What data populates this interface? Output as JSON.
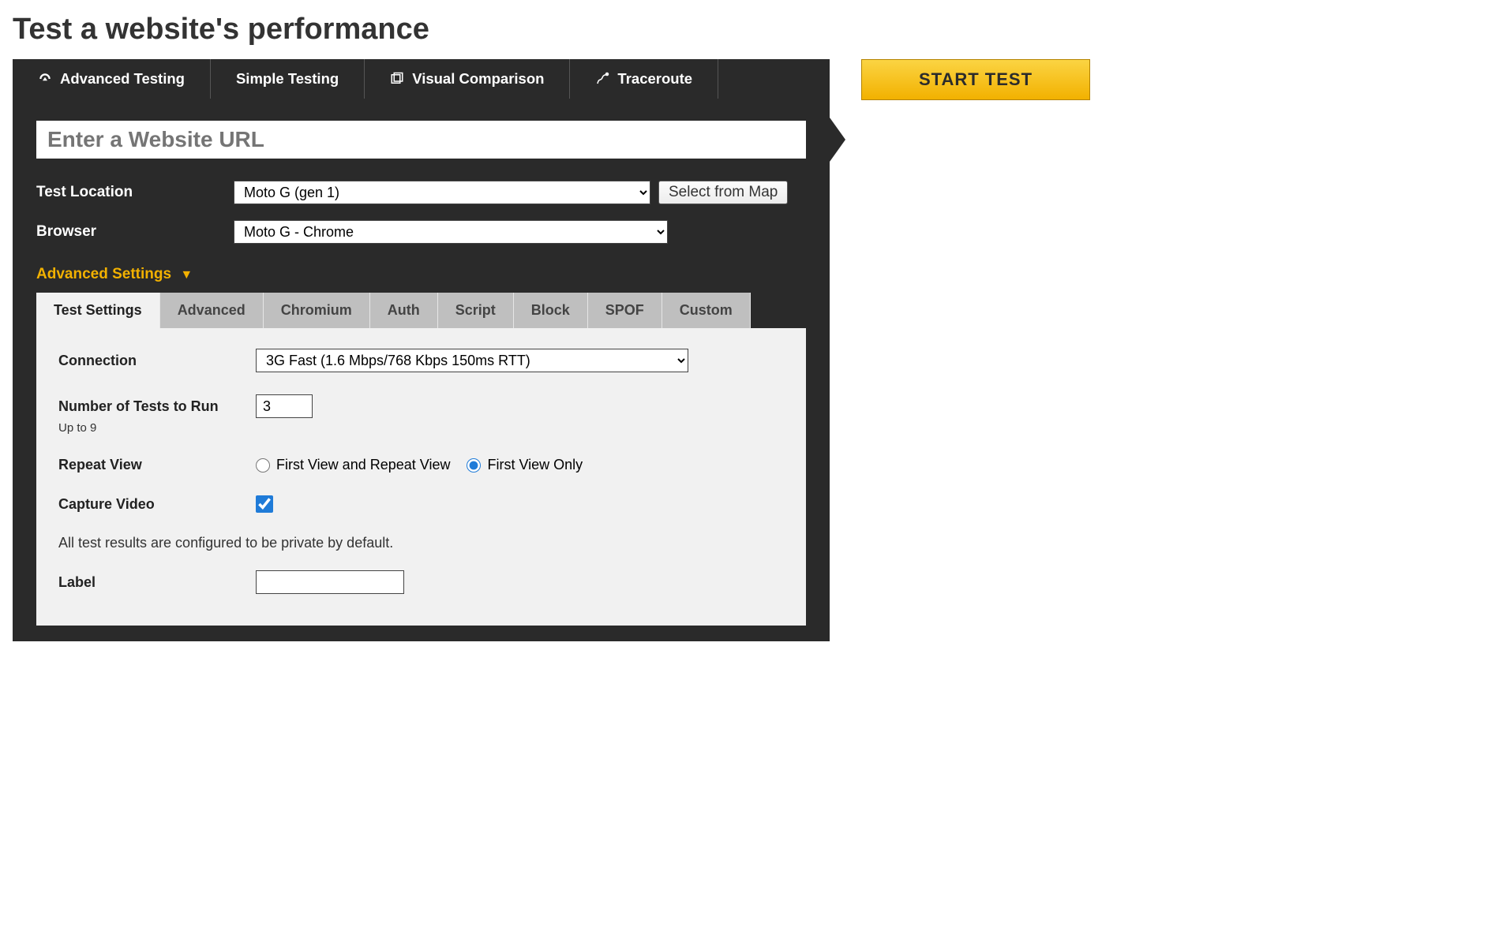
{
  "page_title": "Test a website's performance",
  "tabs": {
    "advanced": "Advanced Testing",
    "simple": "Simple Testing",
    "visual": "Visual Comparison",
    "traceroute": "Traceroute"
  },
  "url_input": {
    "placeholder": "Enter a Website URL",
    "value": ""
  },
  "labels": {
    "location": "Test Location",
    "browser": "Browser",
    "advanced_settings": "Advanced Settings",
    "connection": "Connection",
    "num_tests": "Number of Tests to Run",
    "num_tests_note": "Up to 9",
    "repeat_view": "Repeat View",
    "capture_video": "Capture Video",
    "label_field": "Label"
  },
  "location_select": {
    "selected": "Moto G (gen 1)"
  },
  "select_map_button": "Select from Map",
  "browser_select": {
    "selected": "Moto G - Chrome"
  },
  "subtabs": {
    "test_settings": "Test Settings",
    "advanced": "Advanced",
    "chromium": "Chromium",
    "auth": "Auth",
    "script": "Script",
    "block": "Block",
    "spof": "SPOF",
    "custom": "Custom"
  },
  "connection_select": {
    "selected": "3G Fast (1.6 Mbps/768 Kbps 150ms RTT)"
  },
  "num_tests_value": "3",
  "repeat_view": {
    "both": "First View and Repeat View",
    "first_only": "First View Only",
    "selected": "first_only"
  },
  "capture_video_checked": true,
  "private_note": "All test results are configured to be private by default.",
  "label_value": "",
  "start_button": "START TEST"
}
